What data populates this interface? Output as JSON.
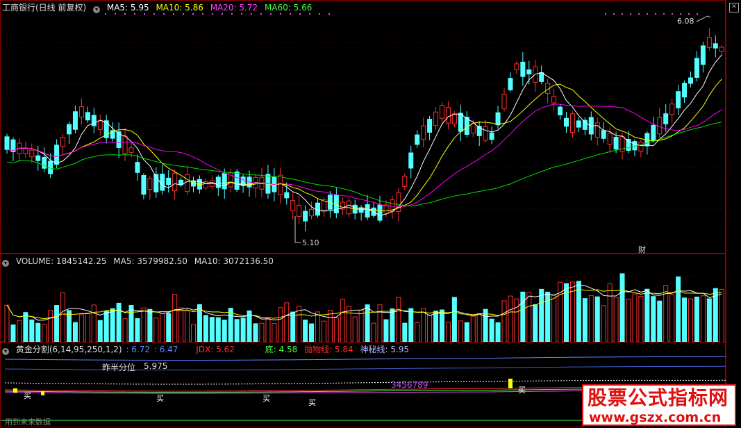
{
  "price_header": {
    "title": "工商银行(日线 前复权)",
    "ma5": "MA5: 5.95",
    "ma10": "MA10: 5.86",
    "ma20": "MA20: 5.72",
    "ma60": "MA60: 5.66"
  },
  "price_annotations": {
    "high": "6.08",
    "low": "5.10",
    "fin_marker": "财"
  },
  "volume_header": {
    "volume": "VOLUME: 1845142.25",
    "ma5": "MA5: 3579982.50",
    "ma10": "MA10: 3072136.50"
  },
  "gold_header": {
    "title": "黄金分割(6,14,95,250,1,2)",
    "v1": ": 6.72",
    "v2": ": 6.47",
    "jdx": "JDX: 5.62",
    "di": "底: 4.58",
    "pwx": "抛物线: 5.84",
    "smx": "神秘线: 5.95"
  },
  "gold_annotations": {
    "half": "昨半分位",
    "half_value": "5.975",
    "buy": "买",
    "seq": "3456789",
    "future": "用到未来数据"
  },
  "watermark": {
    "title": "股票公式指标网",
    "url": "www.gszx.com.cn"
  },
  "colors": {
    "up": "#ff3030",
    "down": "#54ffff",
    "ma5": "#ffffff",
    "ma10": "#ffff00",
    "ma20": "#ff00ff",
    "ma60": "#00e000"
  },
  "icons": {
    "close": "close-icon",
    "menu": "circle-menu-icon"
  }
}
